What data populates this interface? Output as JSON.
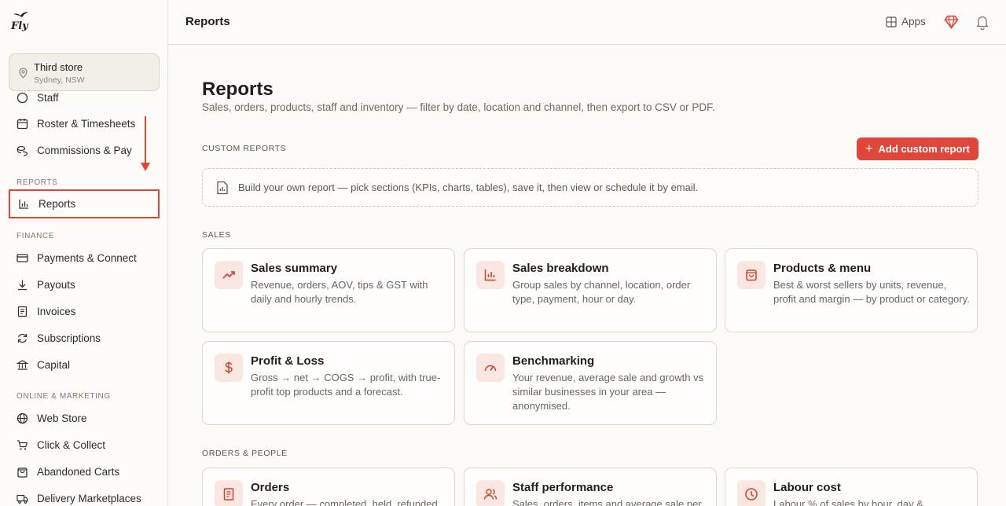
{
  "logo": {
    "text": "Fly"
  },
  "store": {
    "name": "Third store",
    "location": "Sydney, NSW"
  },
  "sidebar": {
    "items_top": [
      {
        "label": "Staff",
        "icon": "smile-icon"
      },
      {
        "label": "Roster & Timesheets",
        "icon": "calendar-icon"
      },
      {
        "label": "Commissions & Pay",
        "icon": "coins-icon"
      }
    ],
    "sections": {
      "reports": "REPORTS",
      "finance": "FINANCE",
      "online": "ONLINE & MARKETING"
    },
    "reports_item": {
      "label": "Reports",
      "icon": "bar-chart-icon"
    },
    "finance_items": [
      {
        "label": "Payments & Connect",
        "icon": "credit-card-icon"
      },
      {
        "label": "Payouts",
        "icon": "download-icon"
      },
      {
        "label": "Invoices",
        "icon": "invoice-icon"
      },
      {
        "label": "Subscriptions",
        "icon": "refresh-icon"
      },
      {
        "label": "Capital",
        "icon": "bank-icon"
      }
    ],
    "online_items": [
      {
        "label": "Web Store",
        "icon": "globe-icon"
      },
      {
        "label": "Click & Collect",
        "icon": "cart-icon"
      },
      {
        "label": "Abandoned Carts",
        "icon": "bag-icon"
      },
      {
        "label": "Delivery Marketplaces",
        "icon": "truck-icon"
      }
    ]
  },
  "topbar": {
    "title": "Reports",
    "apps_label": "Apps"
  },
  "page": {
    "title": "Reports",
    "subtitle": "Sales, orders, products, staff and inventory — filter by date, location and channel, then export to CSV or PDF.",
    "custom_section": "CUSTOM REPORTS",
    "add_button": "Add custom report",
    "custom_hint": "Build your own report — pick sections (KPIs, charts, tables), save it, then view or schedule it by email.",
    "sales_section": "SALES",
    "orders_section": "ORDERS & PEOPLE"
  },
  "cards": [
    {
      "title": "Sales summary",
      "desc": "Revenue, orders, AOV, tips & GST with daily and hourly trends.",
      "icon": "trend-up-icon"
    },
    {
      "title": "Sales breakdown",
      "desc": "Group sales by channel, location, order type, payment, hour or day.",
      "icon": "bar-chart-icon"
    },
    {
      "title": "Products & menu",
      "desc": "Best & worst sellers by units, revenue, profit and margin — by product or category.",
      "icon": "shopping-bag-icon"
    },
    {
      "title": "Profit & Loss",
      "desc": "Gross → net → COGS → profit, with true-profit top products and a forecast.",
      "icon": "dollar-icon"
    },
    {
      "title": "Benchmarking",
      "desc": "Your revenue, average sale and growth vs similar businesses in your area — anonymised.",
      "icon": "gauge-icon"
    },
    {
      "title": "Orders",
      "desc": "Every order — completed, held, refunded",
      "icon": "receipt-icon"
    },
    {
      "title": "Staff performance",
      "desc": "Sales, orders, items and average sale per",
      "icon": "users-icon"
    },
    {
      "title": "Labour cost",
      "desc": "Labour % of sales by hour, day &",
      "icon": "clock-icon"
    }
  ]
}
